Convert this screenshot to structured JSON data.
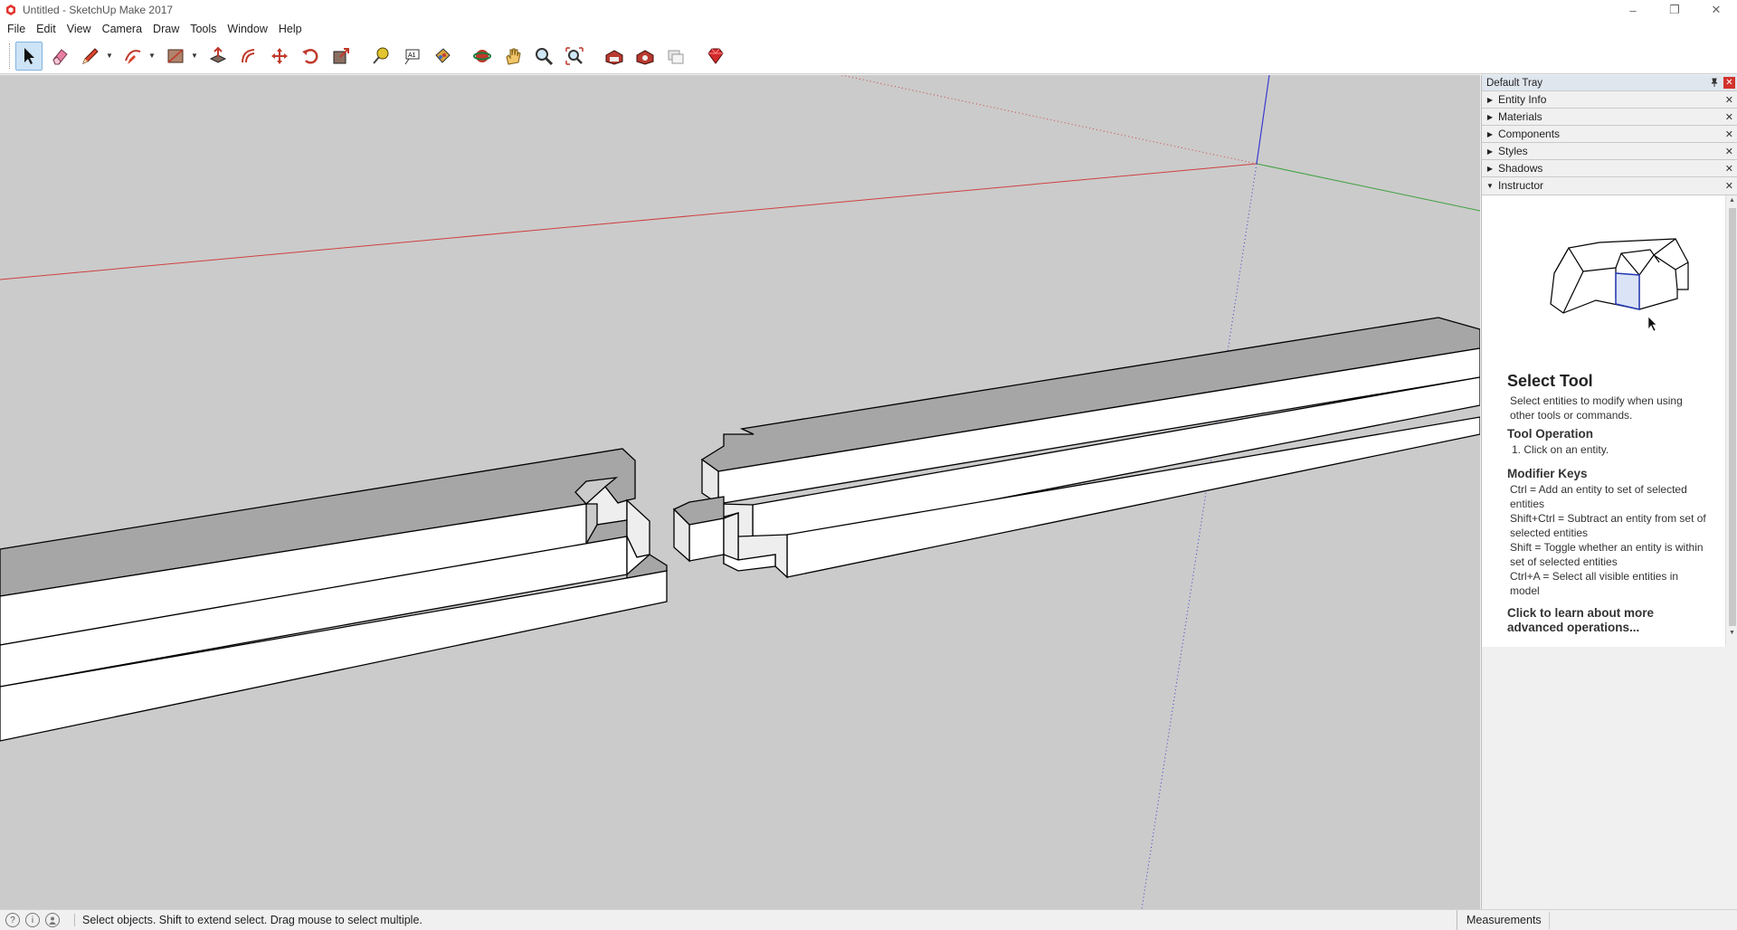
{
  "window": {
    "title": "Untitled - SketchUp Make 2017",
    "controls": [
      "–",
      "❐",
      "✕"
    ]
  },
  "menu": [
    "File",
    "Edit",
    "View",
    "Camera",
    "Draw",
    "Tools",
    "Window",
    "Help"
  ],
  "toolbar": {
    "tools": [
      {
        "name": "select-tool",
        "icon": "arrow-cursor-icon",
        "active": true
      },
      {
        "name": "eraser-tool",
        "icon": "eraser-icon"
      },
      {
        "name": "line-tool",
        "icon": "pencil-icon",
        "dropdown": true
      },
      {
        "name": "arc-tool",
        "icon": "arc-icon",
        "dropdown": true
      },
      {
        "name": "rectangle-tool",
        "icon": "rectangle-icon",
        "dropdown": true
      },
      {
        "name": "push-pull-tool",
        "icon": "push-pull-icon"
      },
      {
        "name": "offset-tool",
        "icon": "offset-icon"
      },
      {
        "name": "move-tool",
        "icon": "move-icon"
      },
      {
        "name": "rotate-tool",
        "icon": "rotate-icon"
      },
      {
        "name": "scale-tool",
        "icon": "scale-icon"
      },
      {
        "name": "tape-measure-tool",
        "icon": "tape-measure-icon"
      },
      {
        "name": "text-tool",
        "icon": "text-icon"
      },
      {
        "name": "paint-bucket-tool",
        "icon": "paint-bucket-icon"
      },
      {
        "name": "orbit-tool",
        "icon": "orbit-icon"
      },
      {
        "name": "pan-tool",
        "icon": "hand-icon"
      },
      {
        "name": "zoom-tool",
        "icon": "magnifier-icon"
      },
      {
        "name": "zoom-extents-tool",
        "icon": "zoom-extents-icon"
      },
      {
        "name": "3d-warehouse-tool",
        "icon": "warehouse-icon"
      },
      {
        "name": "extension-warehouse-tool",
        "icon": "extension-icon"
      },
      {
        "name": "send-to-layout-tool",
        "icon": "layout-icon"
      },
      {
        "name": "extension-manager-tool",
        "icon": "ruby-icon"
      }
    ]
  },
  "tray": {
    "title": "Default Tray",
    "pin_glyph": "📌",
    "close_glyph": "✕",
    "panels": [
      {
        "label": "Entity Info",
        "expanded": false
      },
      {
        "label": "Materials",
        "expanded": false
      },
      {
        "label": "Components",
        "expanded": false
      },
      {
        "label": "Styles",
        "expanded": false
      },
      {
        "label": "Shadows",
        "expanded": false
      },
      {
        "label": "Instructor",
        "expanded": true
      }
    ],
    "collapsed_arrow": "▶",
    "expanded_arrow": "▼",
    "panel_close": "✕"
  },
  "instructor": {
    "heading": "Select Tool",
    "description": "Select entities to modify when using other tools or commands.",
    "operation_title": "Tool Operation",
    "operation_text": "1. Click on an entity.",
    "modifier_title": "Modifier Keys",
    "modifiers": [
      "Ctrl = Add an entity to set of selected entities",
      "Shift+Ctrl = Subtract an entity from set of selected entities",
      "Shift = Toggle whether an entity is within set of selected entities",
      "Ctrl+A = Select all visible entities in model"
    ],
    "learn_more": "Click to learn about more advanced operations..."
  },
  "status": {
    "text": "Select objects. Shift to extend select. Drag mouse to select multiple.",
    "icons": [
      "?",
      "i",
      "👤"
    ],
    "measurements_label": "Measurements",
    "measurements_value": ""
  },
  "colors": {
    "viewport_bg": "#cbcbcb",
    "red_axis": "#d04040",
    "green_axis": "#3fa03f",
    "blue_axis": "#3a3ad0",
    "selected_tool": "#cde3f6"
  }
}
